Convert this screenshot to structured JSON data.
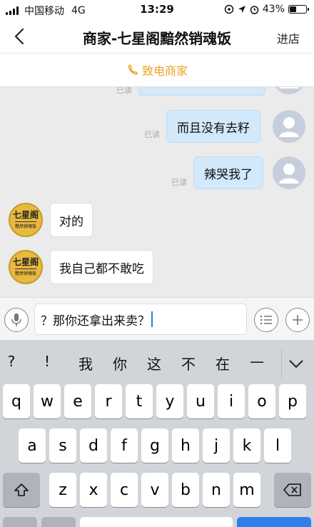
{
  "status_bar": {
    "carrier": "中国移动",
    "network": "4G",
    "time": "13:29",
    "battery_text": "43%",
    "battery_level": 0.43
  },
  "nav": {
    "title": "商家-七星阁黯然销魂饭",
    "right_label": "进店"
  },
  "call_bar": {
    "label": "致电商家"
  },
  "messages_me": [
    {
      "text": "而且没有去籽",
      "read": "已读"
    },
    {
      "text": "辣哭我了",
      "read": "已读"
    }
  ],
  "partial_read": "已读",
  "messages_shop": [
    {
      "text": "对的"
    },
    {
      "text": "我自己都不敢吃"
    }
  ],
  "shop_avatar": {
    "line1": "七星阁",
    "line2": "黯然销魂饭"
  },
  "input": {
    "value": "？那你还拿出来卖？"
  },
  "candidates": [
    "?",
    "!",
    "我",
    "你",
    "这",
    "不",
    "在",
    "—"
  ],
  "keyboard": {
    "row1": [
      "q",
      "w",
      "e",
      "r",
      "t",
      "y",
      "u",
      "i",
      "o",
      "p"
    ],
    "row2": [
      "a",
      "s",
      "d",
      "f",
      "g",
      "h",
      "j",
      "k",
      "l"
    ],
    "row3": [
      "z",
      "x",
      "c",
      "v",
      "b",
      "n",
      "m"
    ]
  },
  "icons": [
    "back-icon",
    "phone-icon",
    "voice-icon",
    "emoji-list-icon",
    "plus-icon",
    "shift-icon",
    "delete-icon",
    "chevron-down-icon",
    "user-avatar-icon"
  ]
}
